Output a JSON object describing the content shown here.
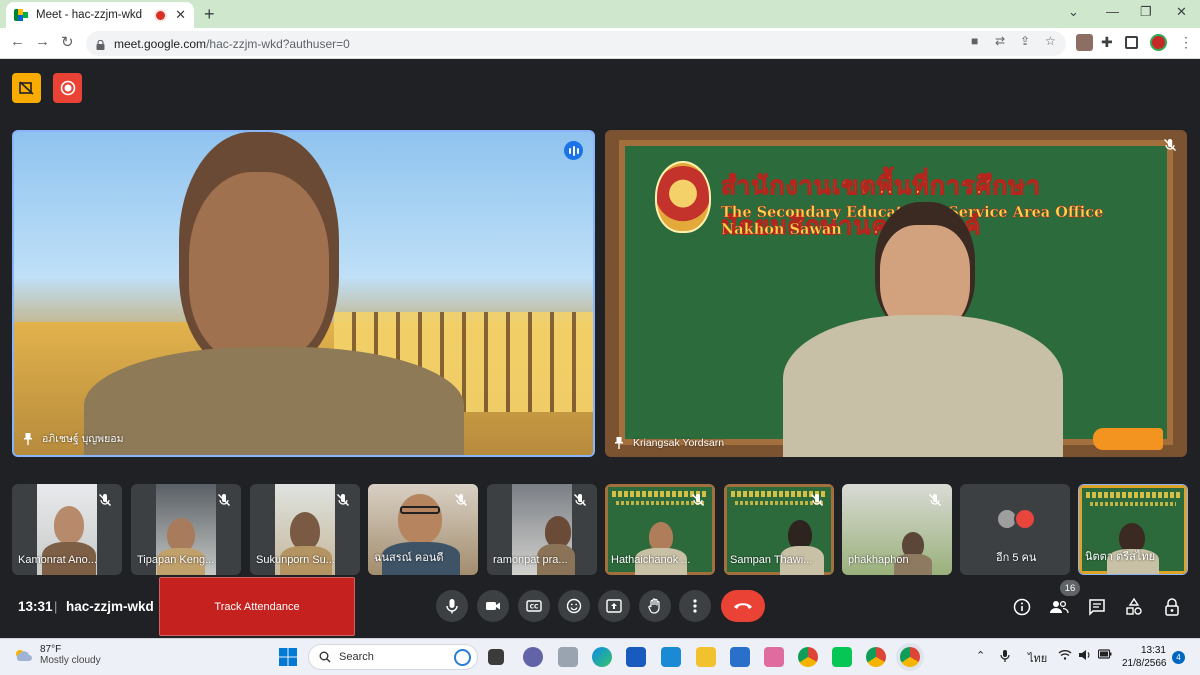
{
  "browser": {
    "tab_title": "Meet - hac-zzjm-wkd",
    "url_domain": "meet.google.com",
    "url_path": "/hac-zzjm-wkd?authuser=0"
  },
  "meet": {
    "main_tiles": [
      {
        "name": "อภิเชษฐ์ บุญพยอม",
        "state": "speaking"
      },
      {
        "name": "Kriangsak Yordsarn",
        "state": "muted"
      }
    ],
    "board_text_th": "สำนักงานเขตพื้นที่การศึกษามัธยมศึกษานครสวรรค์",
    "board_text_en": "The Secondary Educational Service Area Office Nakhon Sawan",
    "participants": [
      {
        "name": "Kamonrat Ano...",
        "muted": true
      },
      {
        "name": "Tipapan Keng...",
        "muted": true
      },
      {
        "name": "Sukunporn Su...",
        "muted": true
      },
      {
        "name": "ฉนสรณ์ คอนดี",
        "muted": true
      },
      {
        "name": "ramonpat pra...",
        "muted": true
      },
      {
        "name": "Hathaichanok ...",
        "muted": true
      },
      {
        "name": "Sampan Thawi...",
        "muted": true
      },
      {
        "name": "phakhaphon",
        "muted": true
      },
      {
        "name": "อีก 5 คน",
        "muted": false
      },
      {
        "name": "นิตตา ตรีสไทย",
        "muted": false
      }
    ],
    "time": "13:31",
    "meeting_code": "hac-zzjm-wkd",
    "track_attendance_label": "Track Attendance",
    "people_count": "16",
    "colors": {
      "end_call": "#ea4335",
      "track": "#c5221f",
      "speaking": "#1a73e8"
    }
  },
  "taskbar": {
    "weather_temp": "87°F",
    "weather_desc": "Mostly cloudy",
    "search_placeholder": "Search",
    "lang": "ไทย",
    "time": "13:31",
    "date": "21/8/2566",
    "notifications": "4"
  }
}
